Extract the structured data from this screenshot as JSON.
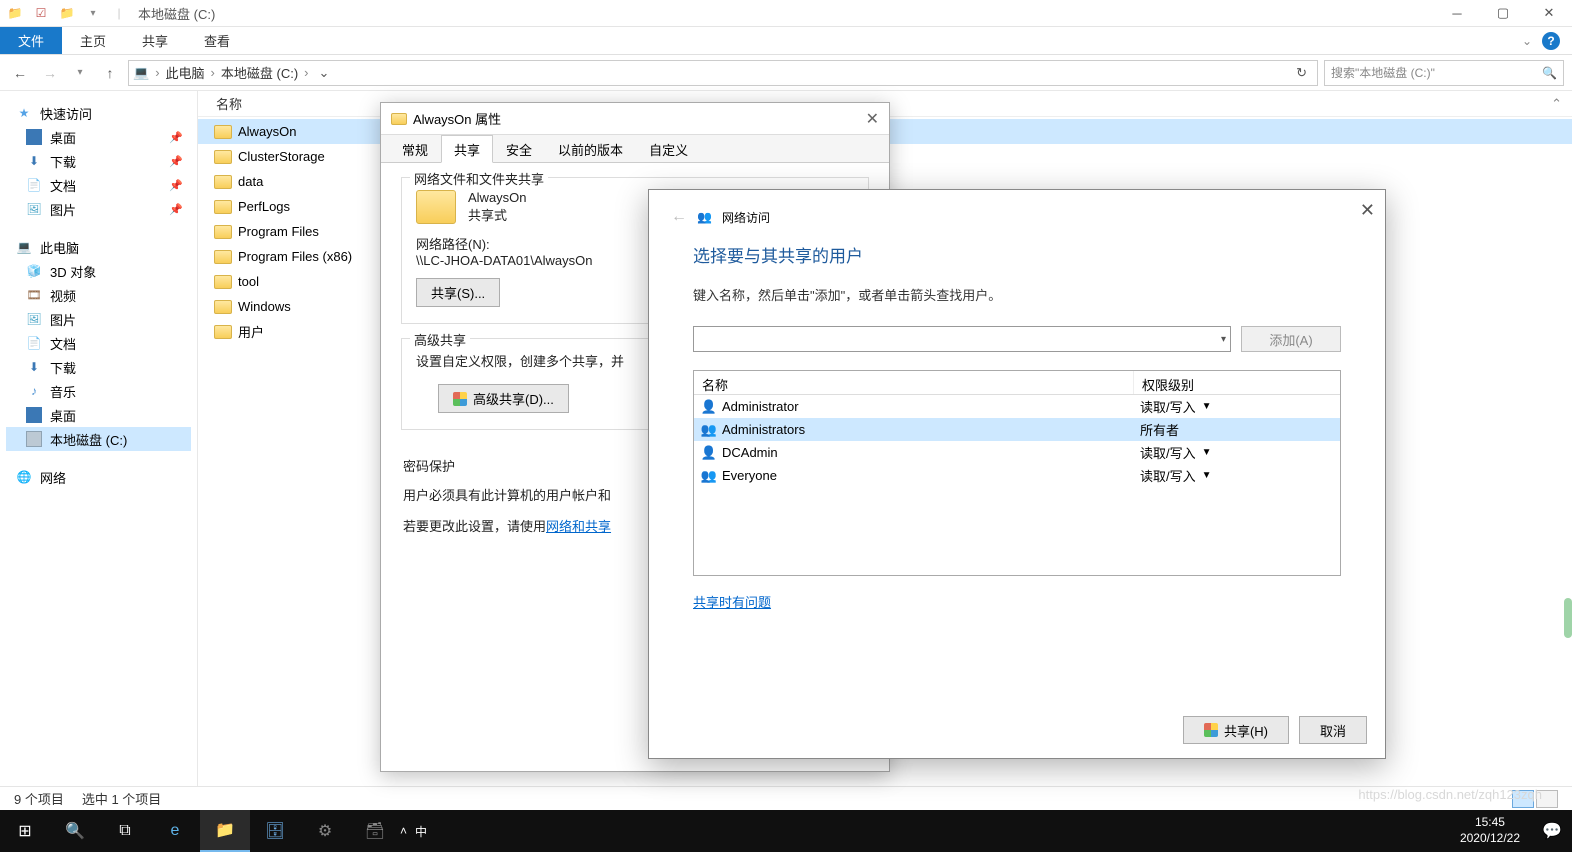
{
  "title": "本地磁盘 (C:)",
  "ribbon": {
    "file": "文件",
    "tabs": [
      "主页",
      "共享",
      "查看"
    ]
  },
  "addr": {
    "root": "此电脑",
    "cur": "本地磁盘 (C:)",
    "search_ph": "搜索\"本地磁盘 (C:)\""
  },
  "nav": {
    "quick": "快速访问",
    "quick_items": [
      "桌面",
      "下载",
      "文档",
      "图片"
    ],
    "pc": "此电脑",
    "pc_items": [
      "3D 对象",
      "视频",
      "图片",
      "文档",
      "下载",
      "音乐",
      "桌面",
      "本地磁盘 (C:)"
    ],
    "network": "网络"
  },
  "col_name": "名称",
  "files": [
    "AlwaysOn",
    "ClusterStorage",
    "data",
    "PerfLogs",
    "Program Files",
    "Program Files (x86)",
    "tool",
    "Windows",
    "用户"
  ],
  "status": {
    "count": "9 个项目",
    "sel": "选中 1 个项目"
  },
  "prop": {
    "title": "AlwaysOn 属性",
    "tabs": [
      "常规",
      "共享",
      "安全",
      "以前的版本",
      "自定义"
    ],
    "g1": "网络文件和文件夹共享",
    "fname": "AlwaysOn",
    "shared": "共享式",
    "pathlabel": "网络路径(N):",
    "path": "\\\\LC-JHOA-DATA01\\AlwaysOn",
    "sharebtn": "共享(S)...",
    "g2": "高级共享",
    "g2hint": "设置自定义权限，创建多个共享，并",
    "advbtn": "高级共享(D)...",
    "g3": "密码保护",
    "g3l1": "用户必须具有此计算机的用户帐户和",
    "g3l2a": "若要更改此设置，请使用",
    "g3l2b": "网络和共享"
  },
  "wiz": {
    "breadcrumb": "网络访问",
    "title": "选择要与其共享的用户",
    "hint": "键入名称，然后单击\"添加\"，或者单击箭头查找用户。",
    "add": "添加(A)",
    "col_name": "名称",
    "col_perm": "权限级别",
    "users": [
      {
        "name": "Administrator",
        "perm": "读取/写入",
        "dd": true
      },
      {
        "name": "Administrators",
        "perm": "所有者",
        "dd": false
      },
      {
        "name": "DCAdmin",
        "perm": "读取/写入",
        "dd": true
      },
      {
        "name": "Everyone",
        "perm": "读取/写入",
        "dd": true
      }
    ],
    "trouble": "共享时有问题",
    "share": "共享(H)",
    "cancel": "取消"
  },
  "clock": {
    "time": "15:45",
    "date": "2020/12/22"
  },
  "watermark": "https://blog.csdn.net/zqh123zqh"
}
